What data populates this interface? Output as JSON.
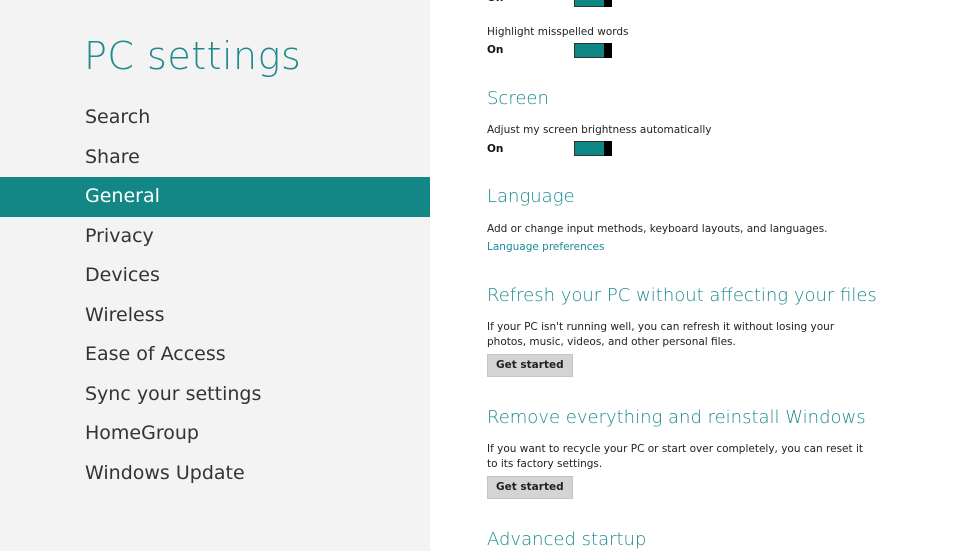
{
  "app": {
    "title": "PC settings"
  },
  "nav": {
    "items": [
      {
        "label": "Search"
      },
      {
        "label": "Share"
      },
      {
        "label": "General"
      },
      {
        "label": "Privacy"
      },
      {
        "label": "Devices"
      },
      {
        "label": "Wireless"
      },
      {
        "label": "Ease of Access"
      },
      {
        "label": "Sync your settings"
      },
      {
        "label": "HomeGroup"
      },
      {
        "label": "Windows Update"
      }
    ],
    "selected": "General"
  },
  "spelling": {
    "top_state": "On",
    "highlight_label": "Highlight misspelled words",
    "highlight_state": "On"
  },
  "screen": {
    "heading": "Screen",
    "brightness_label": "Adjust my screen brightness automatically",
    "brightness_state": "On"
  },
  "language": {
    "heading": "Language",
    "description": "Add or change input methods, keyboard layouts, and languages.",
    "link": "Language preferences"
  },
  "refresh": {
    "heading": "Refresh your PC without affecting your files",
    "description": "If your PC isn't running well, you can refresh it without losing your photos, music, videos, and other personal files.",
    "button": "Get started"
  },
  "reset": {
    "heading": "Remove everything and reinstall Windows",
    "description": "If you want to recycle your PC or start over completely, you can reset it to its factory settings.",
    "button": "Get started"
  },
  "advanced": {
    "heading": "Advanced startup"
  },
  "colors": {
    "accent": "#138786",
    "heading": "#1a8a8e",
    "left_bg": "#f3f3f3"
  }
}
